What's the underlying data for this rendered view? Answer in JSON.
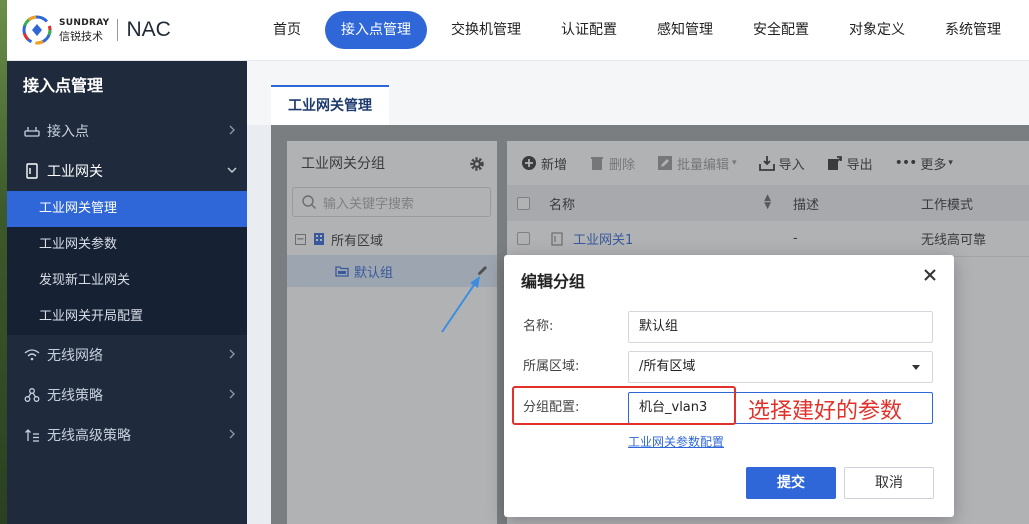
{
  "brand": {
    "english": "SUNDRAY",
    "chinese": "信锐技术",
    "product": "NAC"
  },
  "nav": {
    "items": [
      {
        "label": "首页",
        "active": false
      },
      {
        "label": "接入点管理",
        "active": true
      },
      {
        "label": "交换机管理",
        "active": false
      },
      {
        "label": "认证配置",
        "active": false
      },
      {
        "label": "感知管理",
        "active": false
      },
      {
        "label": "安全配置",
        "active": false
      },
      {
        "label": "对象定义",
        "active": false
      },
      {
        "label": "系统管理",
        "active": false
      }
    ]
  },
  "sidebar": {
    "title": "接入点管理",
    "items": [
      {
        "label": "接入点",
        "icon": "router-icon"
      },
      {
        "label": "工业网关",
        "icon": "gateway-icon",
        "open": true,
        "children": [
          {
            "label": "工业网关管理",
            "active": true
          },
          {
            "label": "工业网关参数"
          },
          {
            "label": "发现新工业网关"
          },
          {
            "label": "工业网关开局配置"
          }
        ]
      },
      {
        "label": "无线网络",
        "icon": "wifi-icon"
      },
      {
        "label": "无线策略",
        "icon": "network-nodes-icon"
      },
      {
        "label": "无线高级策略",
        "icon": "advanced-policy-icon"
      }
    ]
  },
  "tabs": [
    {
      "label": "工业网关管理",
      "active": true
    }
  ],
  "group_panel": {
    "title": "工业网关分组",
    "search_placeholder": "输入关键字搜索",
    "tree": {
      "root": {
        "label": "所有区域",
        "expander": "−"
      },
      "child": {
        "label": "默认组"
      }
    }
  },
  "toolbar": {
    "new": "新增",
    "delete": "删除",
    "batch_edit": "批量编辑",
    "import": "导入",
    "export": "导出",
    "more": "更多"
  },
  "table": {
    "columns": [
      "名称",
      "描述",
      "工作模式"
    ],
    "rows": [
      {
        "name": "工业网关1",
        "desc": "-",
        "mode": "无线高可靠"
      }
    ]
  },
  "modal": {
    "title": "编辑分组",
    "fields": {
      "name": {
        "label": "名称:",
        "value": "默认组"
      },
      "region": {
        "label": "所属区域:",
        "value": "/所有区域"
      },
      "group_config": {
        "label": "分组配置:",
        "value": "机台_vlan3"
      }
    },
    "param_link": "工业网关参数配置",
    "submit": "提交",
    "cancel": "取消"
  },
  "annotation": {
    "text": "选择建好的参数",
    "color": "#e0322b"
  },
  "colors": {
    "accent": "#2f67d8",
    "sidebar_bg": "#1f2b3d"
  }
}
